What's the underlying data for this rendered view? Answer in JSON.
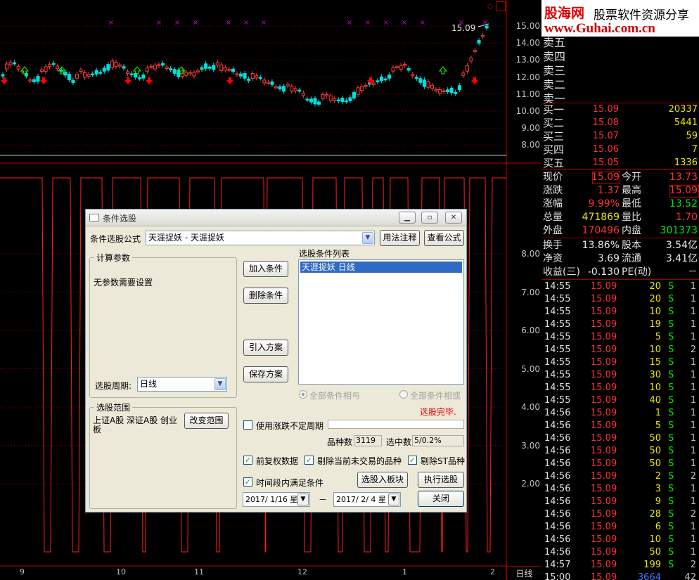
{
  "chart": {
    "price_axis": [
      "15.00",
      "14.00",
      "13.00",
      "12.00",
      "11.00",
      "10.00",
      "9.00",
      "8.00"
    ],
    "indicator_axis": [
      "8.00",
      "7.00",
      "6.00",
      "5.00",
      "4.00",
      "3.00",
      "2.00"
    ],
    "x_labels": [
      "9",
      "10",
      "11",
      "12",
      "1",
      "2"
    ],
    "last_price_label": "15.09",
    "period_tab": "日线",
    "colors": {
      "up": "#ff3c3c",
      "down": "#00e0e0",
      "marker": "#d000d0",
      "indicator": "#ff2020",
      "buy_arrow": "#ff0000",
      "sell_arrow": "#00ff00"
    }
  },
  "logo": {
    "cn": "股海网",
    "slogan": "股票软件资源分享",
    "url": "www.Guhai.com.cn"
  },
  "quote": {
    "sell": [
      {
        "label": "卖五",
        "price": "",
        "vol": ""
      },
      {
        "label": "卖四",
        "price": "",
        "vol": ""
      },
      {
        "label": "卖三",
        "price": "",
        "vol": ""
      },
      {
        "label": "卖二",
        "price": "",
        "vol": ""
      },
      {
        "label": "卖一",
        "price": "",
        "vol": ""
      }
    ],
    "buy": [
      {
        "label": "买一",
        "price": "15.09",
        "vol": "20337"
      },
      {
        "label": "买二",
        "price": "15.08",
        "vol": "5441"
      },
      {
        "label": "买三",
        "price": "15.07",
        "vol": "59"
      },
      {
        "label": "买四",
        "price": "15.06",
        "vol": "7"
      },
      {
        "label": "买五",
        "price": "15.05",
        "vol": "1336"
      }
    ],
    "stats": [
      {
        "l1": "现价",
        "v1": "15.09",
        "l2": "今开",
        "v2": "13.73"
      },
      {
        "l1": "涨跌",
        "v1": "1.37",
        "l2": "最高",
        "v2": "15.09"
      },
      {
        "l1": "涨幅",
        "v1": "9.99%",
        "l2": "最低",
        "v2": "13.52"
      },
      {
        "l1": "总量",
        "v1": "471869",
        "l2": "量比",
        "v2": "1.70"
      },
      {
        "l1": "外盘",
        "v1": "170496",
        "l2": "内盘",
        "v2": "301373"
      }
    ],
    "fin": [
      {
        "l1": "换手",
        "v1": "13.86%",
        "l2": "股本",
        "v2": "3.54亿"
      },
      {
        "l1": "净资",
        "v1": "3.69",
        "l2": "流通",
        "v2": "3.41亿"
      },
      {
        "l1": "收益(三)",
        "v1": "-0.130",
        "l2": "PE(动)",
        "v2": "－"
      }
    ]
  },
  "ticks": [
    {
      "t": "14:55",
      "p": "15.09",
      "v": "20",
      "f": "S",
      "n": "1"
    },
    {
      "t": "14:55",
      "p": "15.09",
      "v": "20",
      "f": "S",
      "n": "1"
    },
    {
      "t": "14:55",
      "p": "15.09",
      "v": "10",
      "f": "S",
      "n": "1"
    },
    {
      "t": "14:55",
      "p": "15.09",
      "v": "19",
      "f": "S",
      "n": "1"
    },
    {
      "t": "14:55",
      "p": "15.09",
      "v": "5",
      "f": "S",
      "n": "1"
    },
    {
      "t": "14:55",
      "p": "15.09",
      "v": "10",
      "f": "S",
      "n": "2"
    },
    {
      "t": "14:55",
      "p": "15.09",
      "v": "15",
      "f": "S",
      "n": "1"
    },
    {
      "t": "14:55",
      "p": "15.09",
      "v": "30",
      "f": "S",
      "n": "1"
    },
    {
      "t": "14:55",
      "p": "15.09",
      "v": "10",
      "f": "S",
      "n": "1"
    },
    {
      "t": "14:55",
      "p": "15.09",
      "v": "40",
      "f": "S",
      "n": "1"
    },
    {
      "t": "14:56",
      "p": "15.09",
      "v": "1",
      "f": "S",
      "n": "1"
    },
    {
      "t": "14:56",
      "p": "15.09",
      "v": "5",
      "f": "S",
      "n": "1"
    },
    {
      "t": "14:56",
      "p": "15.09",
      "v": "50",
      "f": "S",
      "n": "1"
    },
    {
      "t": "14:56",
      "p": "15.09",
      "v": "50",
      "f": "S",
      "n": "1"
    },
    {
      "t": "14:56",
      "p": "15.09",
      "v": "50",
      "f": "S",
      "n": "1"
    },
    {
      "t": "14:56",
      "p": "15.09",
      "v": "2",
      "f": "S",
      "n": "2"
    },
    {
      "t": "14:56",
      "p": "15.09",
      "v": "3",
      "f": "S",
      "n": "1"
    },
    {
      "t": "14:56",
      "p": "15.09",
      "v": "9",
      "f": "S",
      "n": "1"
    },
    {
      "t": "14:56",
      "p": "15.09",
      "v": "28",
      "f": "S",
      "n": "2"
    },
    {
      "t": "14:56",
      "p": "15.09",
      "v": "6",
      "f": "S",
      "n": "1"
    },
    {
      "t": "14:56",
      "p": "15.09",
      "v": "10",
      "f": "S",
      "n": "1"
    },
    {
      "t": "14:56",
      "p": "15.09",
      "v": "50",
      "f": "S",
      "n": "1"
    },
    {
      "t": "14:57",
      "p": "15.09",
      "v": "199",
      "f": "S",
      "n": "2"
    },
    {
      "t": "15:00",
      "p": "15.09",
      "v": "3664",
      "f": "",
      "n": "42"
    }
  ],
  "dialog": {
    "title": "条件选股",
    "formula_label": "条件选股公式",
    "formula_value": "天涯捉妖        - 天涯捉妖",
    "btn_usage": "用法注释",
    "btn_view": "查看公式",
    "calc_params_title": "计算参数",
    "no_params": "无参数需要设置",
    "period_label": "选股周期:",
    "period_value": "日线",
    "scope_title": "选股范围",
    "scope_value": "上证A股  深证A股  创业板",
    "btn_change_scope": "改变范围",
    "btn_add": "加入条件",
    "btn_delete": "删除条件",
    "btn_import": "引入方案",
    "btn_save": "保存方案",
    "cond_list_title": "选股条件列表",
    "cond_items": [
      "天涯捉妖   日线"
    ],
    "radio_and": "全部条件相与",
    "radio_or": "全部条件相或",
    "status": "选股完毕.",
    "chk_uncertain": "使用涨跌不定周期",
    "count_label": "品种数",
    "count_value": "3119",
    "selected_label": "选中数",
    "selected_value": "5/0.2%",
    "chk_fq": "前复权数据",
    "chk_exclude_untraded": "剔除当前未交易的品种",
    "chk_exclude_st": "剔除ST品种",
    "chk_period": "时间段内满足条件",
    "btn_to_block": "选股入板块",
    "btn_execute": "执行选股",
    "date_from": "2017/ 1/16 星",
    "date_to": "2017/ 2/ 4 星",
    "date_sep": "－",
    "btn_close": "关闭"
  }
}
